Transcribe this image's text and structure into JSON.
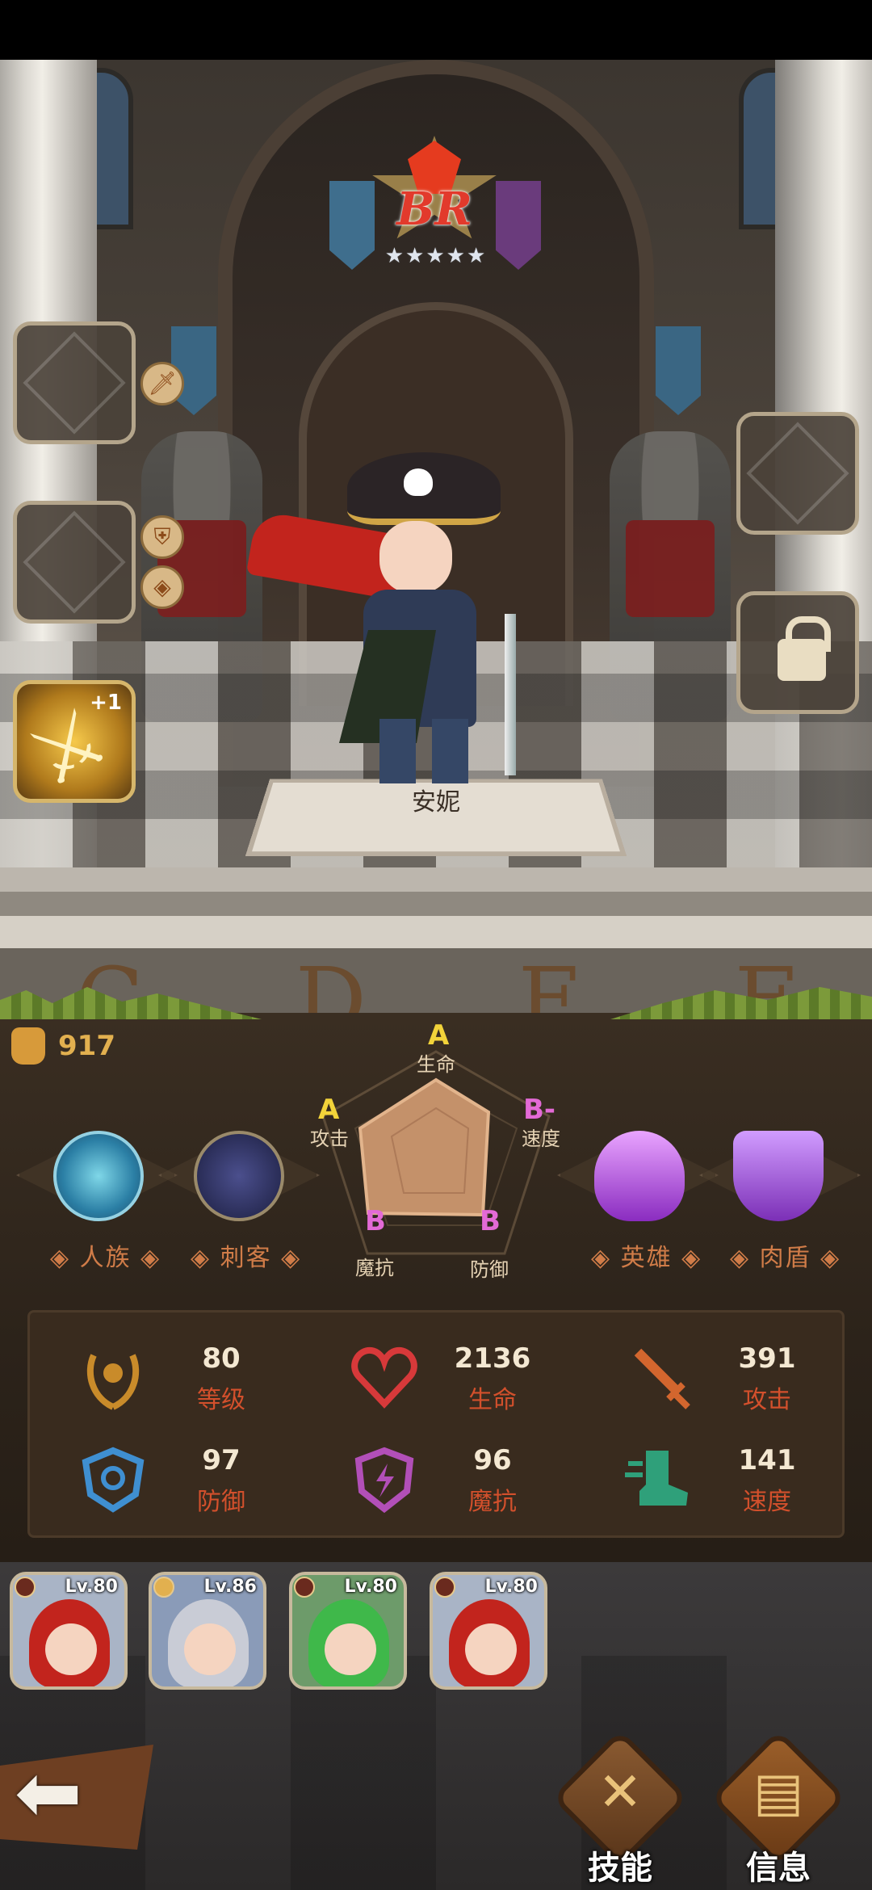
{
  "hero": {
    "name": "安妮",
    "rank": "BR",
    "stars": [
      "★",
      "★",
      "★",
      "★",
      "★"
    ]
  },
  "equipment": {
    "weapon_plus": "+1"
  },
  "scene": {
    "floor_letters": [
      "C",
      "D",
      "E",
      "F"
    ]
  },
  "power": "917",
  "traits": [
    {
      "label": "◈ 人族 ◈",
      "icon": "crown-icon"
    },
    {
      "label": "◈ 刺客 ◈",
      "icon": "portrait-icon"
    },
    {
      "label": "◈ 英雄 ◈",
      "icon": "helmet-icon"
    },
    {
      "label": "◈ 肉盾 ◈",
      "icon": "shield-icon"
    }
  ],
  "radar": {
    "hp": {
      "grade": "A",
      "label": "生命"
    },
    "atk": {
      "grade": "A",
      "label": "攻击"
    },
    "spd": {
      "grade": "B-",
      "label": "速度"
    },
    "mres": {
      "grade": "B",
      "label": "魔抗"
    },
    "def": {
      "grade": "B",
      "label": "防御"
    }
  },
  "stats": [
    {
      "value": "80",
      "name": "等级",
      "icon": "laurel-icon"
    },
    {
      "value": "2136",
      "name": "生命",
      "icon": "heart-icon"
    },
    {
      "value": "391",
      "name": "攻击",
      "icon": "sword-icon"
    },
    {
      "value": "97",
      "name": "防御",
      "icon": "armor-icon"
    },
    {
      "value": "96",
      "name": "魔抗",
      "icon": "magic-shield-icon"
    },
    {
      "value": "141",
      "name": "速度",
      "icon": "boot-icon"
    }
  ],
  "team": [
    {
      "level": "Lv.80"
    },
    {
      "level": "Lv.86"
    },
    {
      "level": "Lv.80"
    },
    {
      "level": "Lv.80"
    }
  ],
  "actions": {
    "skills": "技能",
    "info": "信息"
  },
  "colors": {
    "accent_gold": "#e2b04f",
    "stat_label": "#d3502c",
    "grade_a": "#f2d33a",
    "grade_b": "#e36ad6"
  }
}
